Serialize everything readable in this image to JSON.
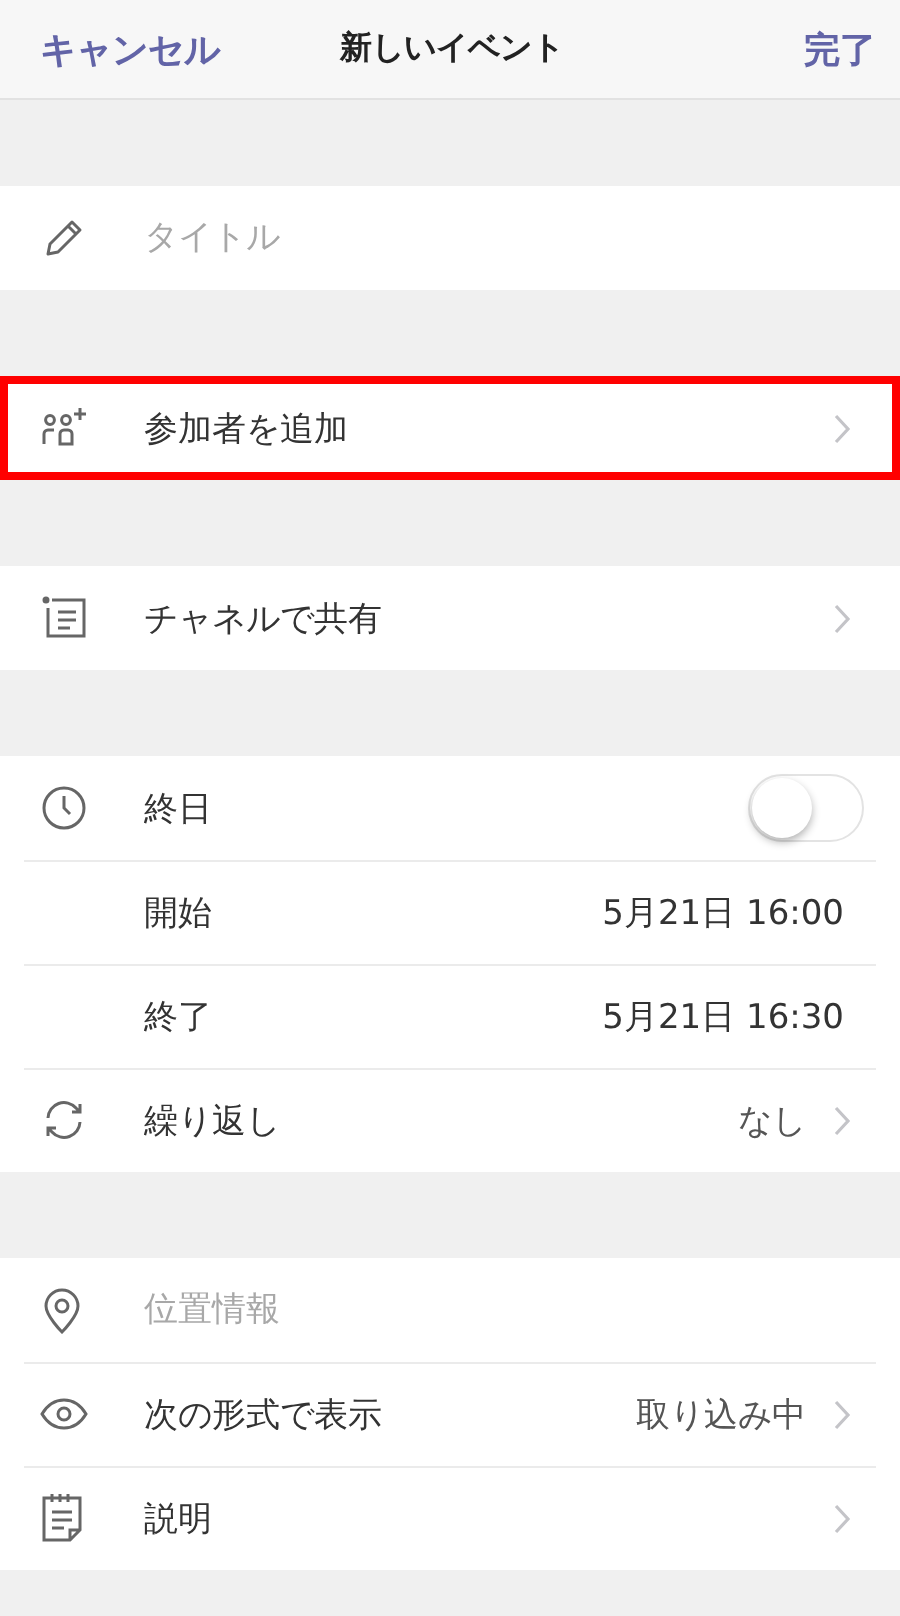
{
  "header": {
    "cancel": "キャンセル",
    "title": "新しいイベント",
    "done": "完了"
  },
  "sections": [
    {
      "rows": [
        {
          "kind": "input",
          "placeholder": "タイトル",
          "highlighted": false
        }
      ]
    },
    {
      "rows": [
        {
          "kind": "link",
          "label": "参加者を追加",
          "highlighted": true
        }
      ]
    },
    {
      "rows": [
        {
          "kind": "link",
          "label": "チャネルで共有",
          "highlighted": false
        }
      ]
    },
    {
      "rows": [
        {
          "kind": "toggle",
          "label": "終日",
          "on": false,
          "highlighted": false
        },
        {
          "kind": "value",
          "label": "開始",
          "value": "5月21日 16:00",
          "highlighted": false
        },
        {
          "kind": "value",
          "label": "終了",
          "value": "5月21日 16:30",
          "highlighted": false
        },
        {
          "kind": "link",
          "label": "繰り返し",
          "value": "なし",
          "highlighted": false
        }
      ]
    },
    {
      "rows": [
        {
          "kind": "input",
          "placeholder": "位置情報",
          "highlighted": false
        },
        {
          "kind": "link",
          "label": "次の形式で表示",
          "value": "取り込み中",
          "highlighted": false
        },
        {
          "kind": "link",
          "label": "説明",
          "highlighted": false
        }
      ]
    }
  ]
}
